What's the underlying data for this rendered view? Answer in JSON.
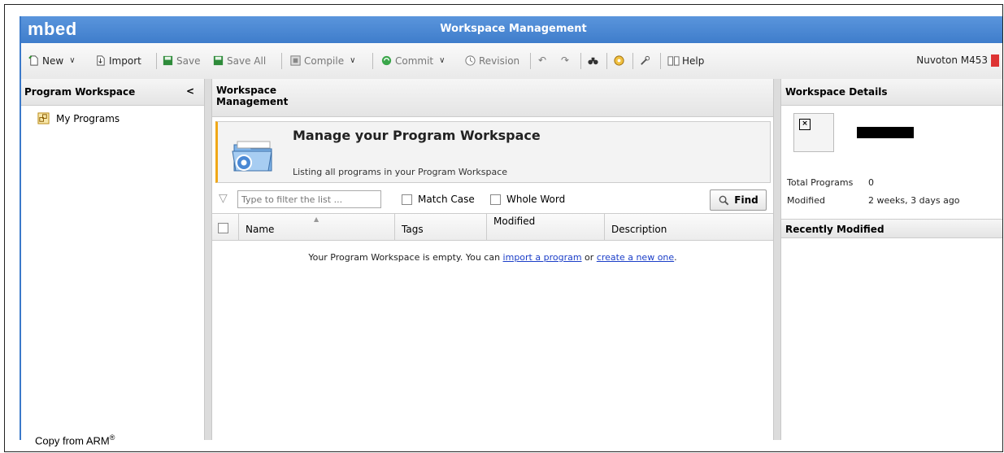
{
  "app": {
    "logo": "mbed",
    "window_title": "Workspace Management"
  },
  "toolbar": {
    "new_label": "New",
    "import_label": "Import",
    "save_label": "Save",
    "save_all_label": "Save All",
    "compile_label": "Compile",
    "commit_label": "Commit",
    "revision_label": "Revision",
    "help_label": "Help",
    "device_label": "Nuvoton M453"
  },
  "left_panel": {
    "title": "Program Workspace",
    "collapse_glyph": "<",
    "tree_items": [
      {
        "label": "My Programs",
        "icon": "programs-folder-icon"
      }
    ]
  },
  "center_panel": {
    "title_line1": "Workspace",
    "title_line2": "Management",
    "banner_title": "Manage your Program Workspace",
    "banner_subtitle": "Listing all programs in your Program Workspace",
    "filter": {
      "placeholder": "Type to filter the list ...",
      "match_case_label": "Match Case",
      "whole_word_label": "Whole Word",
      "find_label": "Find"
    },
    "columns": [
      "Name",
      "Tags",
      "Modified",
      "Description"
    ],
    "empty": {
      "prefix": "Your Program Workspace is empty. You can ",
      "link1": "import a program",
      "middle": " or ",
      "link2": "create a new one",
      "suffix": "."
    }
  },
  "right_panel": {
    "title": "Workspace Details",
    "total_programs_label": "Total Programs",
    "total_programs_value": "0",
    "modified_label": "Modified",
    "modified_value": "2 weeks, 3 days ago",
    "recently_modified_title": "Recently Modified"
  },
  "caption": {
    "text": "Copy from ARM",
    "mark": "®"
  },
  "colors": {
    "titlebar": "#4a88d4",
    "accent_orange": "#f0a818",
    "link": "#1b3ec8"
  }
}
